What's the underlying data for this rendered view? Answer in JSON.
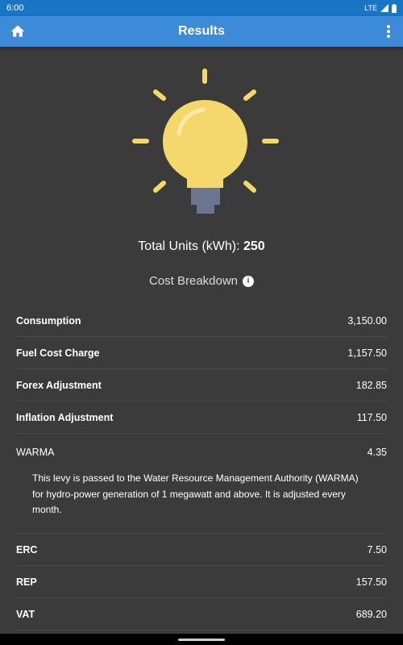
{
  "status_bar": {
    "time": "6:00",
    "network": "LTE"
  },
  "app_bar": {
    "title": "Results",
    "home_icon": "home-icon",
    "more_icon": "more-vert-icon"
  },
  "illustration": {
    "icon": "light-bulb-icon",
    "bulb_color": "#f5d86b",
    "base_color": "#6b7590"
  },
  "summary": {
    "total_units_label": "Total Units (kWh):",
    "total_units_value": "250",
    "breakdown_title": "Cost Breakdown",
    "info_icon": "info-icon"
  },
  "breakdown": [
    {
      "label": "Consumption",
      "value": "3,150.00"
    },
    {
      "label": "Fuel Cost Charge",
      "value": "1,157.50"
    },
    {
      "label": "Forex Adjustment",
      "value": "182.85"
    },
    {
      "label": "Inflation Adjustment",
      "value": "117.50"
    },
    {
      "label": "WARMA",
      "value": "4.35",
      "description": "This levy is passed to the Water Resource Management Authority (WARMA) for hydro-power generation of 1 megawatt and above. It is adjusted every month."
    },
    {
      "label": "ERC",
      "value": "7.50"
    },
    {
      "label": "REP",
      "value": "157.50"
    },
    {
      "label": "VAT",
      "value": "689.20"
    }
  ],
  "colors": {
    "background": "#3b3b3b",
    "status_bar": "#1976c6",
    "app_bar": "#3c8ad8"
  }
}
